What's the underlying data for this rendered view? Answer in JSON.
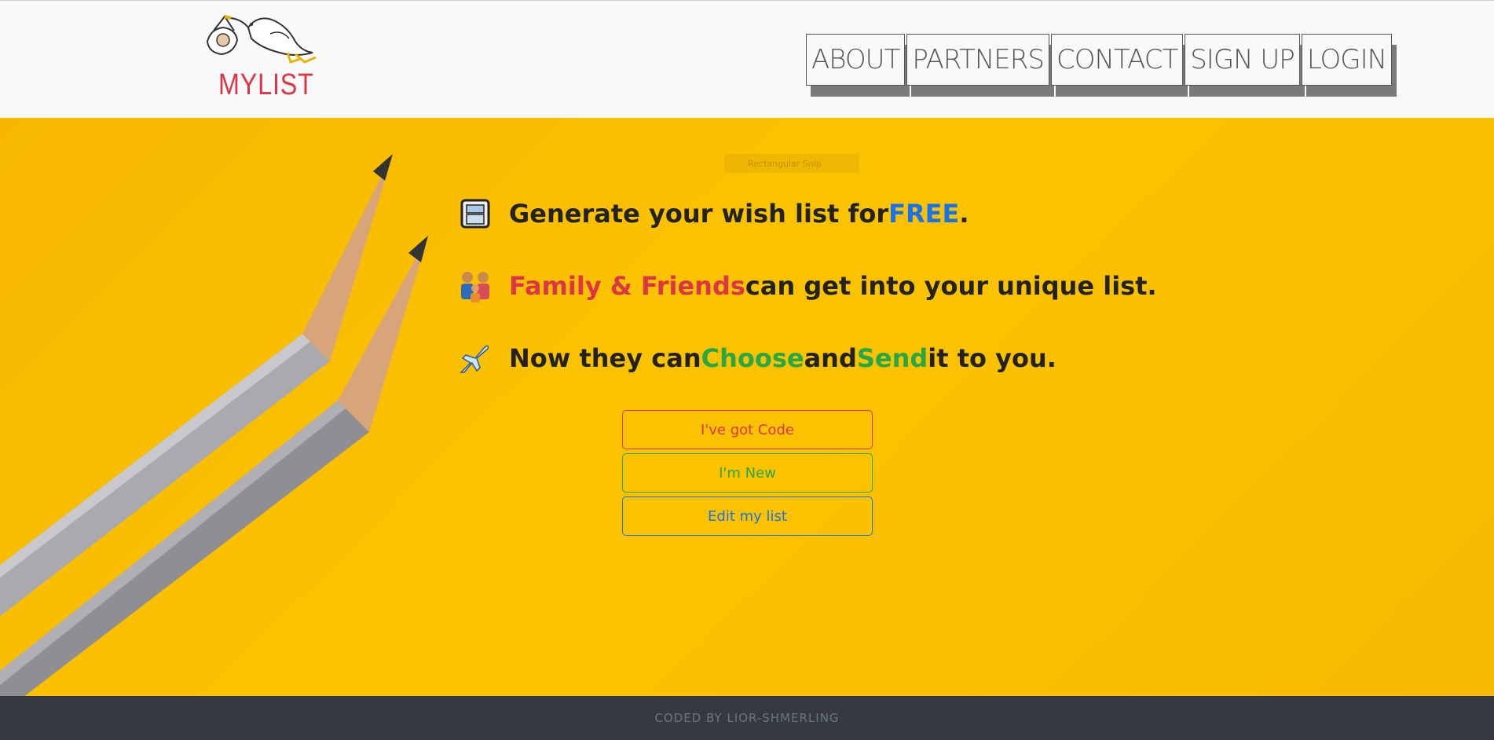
{
  "brand": {
    "name": "MYLIST",
    "logo_icon": "stork-carrying-baby-icon"
  },
  "nav": {
    "items": [
      {
        "label": "ABOUT"
      },
      {
        "label": "PARTNERS"
      },
      {
        "label": "CONTACT"
      },
      {
        "label": "SIGN UP"
      },
      {
        "label": "LOGIN"
      }
    ]
  },
  "hero": {
    "snip_label": "Rectangular Snip",
    "lines": [
      {
        "icon": "window-icon",
        "pre": "Generate your wish list for ",
        "highlight": "FREE",
        "post": "."
      },
      {
        "icon": "family-icon",
        "pre": "",
        "highlight": "Family & Friends",
        "post": " can get into your unique list."
      },
      {
        "icon": "airplane-icon",
        "pre": "Now they can ",
        "highlight": "Choose",
        "mid": " and ",
        "highlight2": "Send",
        "post": " it to you."
      }
    ],
    "buttons": {
      "code": "I've got Code",
      "new": "I'm New",
      "edit": "Edit my list"
    }
  },
  "footer": {
    "text": "CODED BY LIOR-SHMERLING"
  },
  "colors": {
    "brand_red": "#dc3545",
    "blue": "#1a73e8",
    "green": "#28a745",
    "yellow": "#fbc200",
    "footer_bg": "#343a40"
  }
}
